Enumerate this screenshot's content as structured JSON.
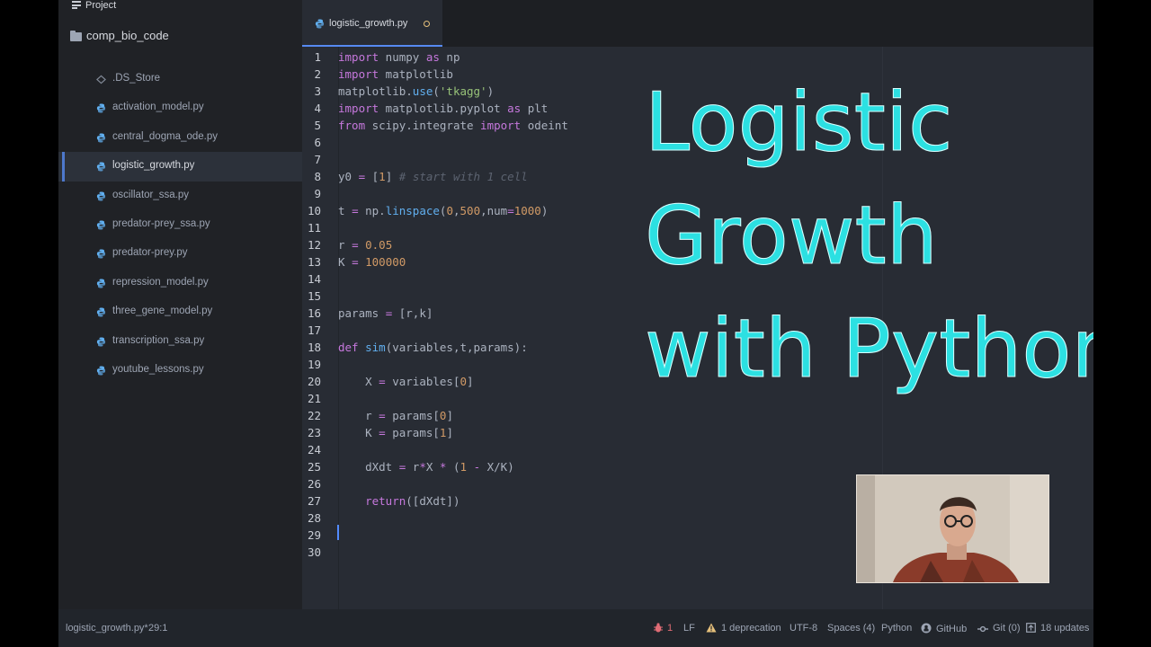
{
  "panel": {
    "title": "Project"
  },
  "tree": {
    "root": "comp_bio_code",
    "files": [
      {
        "name": ".DS_Store",
        "kind": "dsstore",
        "selected": false
      },
      {
        "name": "activation_model.py",
        "kind": "python",
        "selected": false
      },
      {
        "name": "central_dogma_ode.py",
        "kind": "python",
        "selected": false
      },
      {
        "name": "logistic_growth.py",
        "kind": "python",
        "selected": true
      },
      {
        "name": "oscillator_ssa.py",
        "kind": "python",
        "selected": false
      },
      {
        "name": "predator-prey_ssa.py",
        "kind": "python",
        "selected": false
      },
      {
        "name": "predator-prey.py",
        "kind": "python",
        "selected": false
      },
      {
        "name": "repression_model.py",
        "kind": "python",
        "selected": false
      },
      {
        "name": "three_gene_model.py",
        "kind": "python",
        "selected": false
      },
      {
        "name": "transcription_ssa.py",
        "kind": "python",
        "selected": false
      },
      {
        "name": "youtube_lessons.py",
        "kind": "python",
        "selected": false
      }
    ]
  },
  "tab": {
    "label": "logistic_growth.py",
    "modified": true
  },
  "code": [
    [
      [
        "kw",
        "import"
      ],
      [
        "t",
        " numpy "
      ],
      [
        "kw",
        "as"
      ],
      [
        "t",
        " np"
      ]
    ],
    [
      [
        "kw",
        "import"
      ],
      [
        "t",
        " matplotlib"
      ]
    ],
    [
      [
        "t",
        "matplotlib."
      ],
      [
        "fn",
        "use"
      ],
      [
        "t",
        "("
      ],
      [
        "str",
        "'tkagg'"
      ],
      [
        "t",
        ")"
      ]
    ],
    [
      [
        "kw",
        "import"
      ],
      [
        "t",
        " matplotlib.pyplot "
      ],
      [
        "kw",
        "as"
      ],
      [
        "t",
        " plt"
      ]
    ],
    [
      [
        "kw",
        "from"
      ],
      [
        "t",
        " scipy.integrate "
      ],
      [
        "kw",
        "import"
      ],
      [
        "t",
        " odeint"
      ]
    ],
    [],
    [],
    [
      [
        "t",
        "y0 "
      ],
      [
        "kw",
        "="
      ],
      [
        "t",
        " ["
      ],
      [
        "num",
        "1"
      ],
      [
        "t",
        "] "
      ],
      [
        "cmt",
        "# start with 1 cell"
      ]
    ],
    [],
    [
      [
        "t",
        "t "
      ],
      [
        "kw",
        "="
      ],
      [
        "t",
        " np."
      ],
      [
        "fn",
        "linspace"
      ],
      [
        "t",
        "("
      ],
      [
        "num",
        "0"
      ],
      [
        "t",
        ","
      ],
      [
        "num",
        "500"
      ],
      [
        "t",
        ",num"
      ],
      [
        "kw",
        "="
      ],
      [
        "num",
        "1000"
      ],
      [
        "t",
        ")"
      ]
    ],
    [],
    [
      [
        "t",
        "r "
      ],
      [
        "kw",
        "="
      ],
      [
        "t",
        " "
      ],
      [
        "num",
        "0.05"
      ]
    ],
    [
      [
        "t",
        "K "
      ],
      [
        "kw",
        "="
      ],
      [
        "t",
        " "
      ],
      [
        "num",
        "100000"
      ]
    ],
    [],
    [],
    [
      [
        "t",
        "params "
      ],
      [
        "kw",
        "="
      ],
      [
        "t",
        " [r,k]"
      ]
    ],
    [],
    [
      [
        "kw",
        "def"
      ],
      [
        "t",
        " "
      ],
      [
        "fn",
        "sim"
      ],
      [
        "t",
        "(variables,t,params):"
      ]
    ],
    [],
    [
      [
        "t",
        "    X "
      ],
      [
        "kw",
        "="
      ],
      [
        "t",
        " variables["
      ],
      [
        "num",
        "0"
      ],
      [
        "t",
        "]"
      ]
    ],
    [],
    [
      [
        "t",
        "    r "
      ],
      [
        "kw",
        "="
      ],
      [
        "t",
        " params["
      ],
      [
        "num",
        "0"
      ],
      [
        "t",
        "]"
      ]
    ],
    [
      [
        "t",
        "    K "
      ],
      [
        "kw",
        "="
      ],
      [
        "t",
        " params["
      ],
      [
        "num",
        "1"
      ],
      [
        "t",
        "]"
      ]
    ],
    [],
    [
      [
        "t",
        "    dXdt "
      ],
      [
        "kw",
        "="
      ],
      [
        "t",
        " r"
      ],
      [
        "kw",
        "*"
      ],
      [
        "t",
        "X "
      ],
      [
        "kw",
        "*"
      ],
      [
        "t",
        " ("
      ],
      [
        "num",
        "1"
      ],
      [
        "t",
        " "
      ],
      [
        "kw",
        "-"
      ],
      [
        "t",
        " X/K)"
      ]
    ],
    [],
    [
      [
        "t",
        "    "
      ],
      [
        "kw",
        "return"
      ],
      [
        "t",
        "([dXdt])"
      ]
    ],
    [],
    [],
    []
  ],
  "overlay": {
    "lines": [
      "Logistic",
      "Growth",
      "with Python"
    ]
  },
  "status": {
    "file": "logistic_growth.py*",
    "cursor": "29:1",
    "bug_count": "1",
    "line_ending": "LF",
    "deprecation": "1 deprecation",
    "encoding": "UTF-8",
    "indent": "Spaces (4)",
    "grammar": "Python",
    "github": "GitHub",
    "git": "Git (0)",
    "updates": "18 updates"
  },
  "colors": {
    "accent": "#568af2",
    "title_text": "#2ce0e2",
    "bug": "#e06c75",
    "warning": "#e5c07b"
  }
}
